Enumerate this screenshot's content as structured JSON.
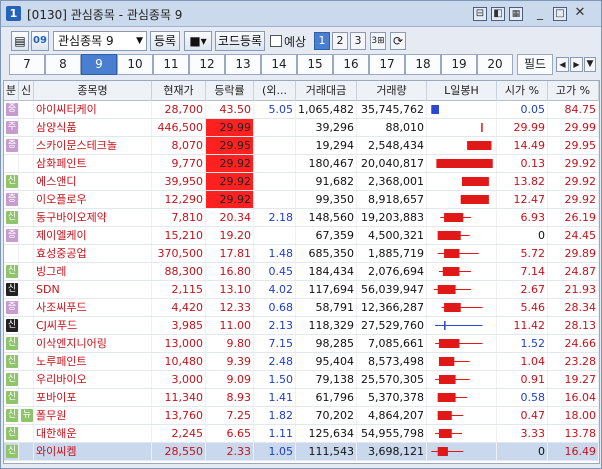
{
  "window": {
    "badge": "1",
    "title": "[0130] 관심종목 - 관심종목 9"
  },
  "toolbar": {
    "watchlist_value": "관심종목 9",
    "register_label": "등록",
    "code_register_label": "코드등록",
    "preview_label": "예상",
    "pages": [
      "1",
      "2",
      "3"
    ]
  },
  "tabs": {
    "items": [
      "7",
      "8",
      "9",
      "10",
      "11",
      "12",
      "13",
      "14",
      "15",
      "16",
      "17",
      "18",
      "19",
      "20"
    ],
    "field_label": "필드"
  },
  "colors": {
    "up": "#c8101a",
    "down": "#1d3fc4",
    "limit_up_bg": "#ff2020",
    "selected_row": "#c9d8ec"
  },
  "columns": [
    "분",
    "신",
    "종목명",
    "현재가",
    "등락률",
    "(외...",
    "거래대금",
    "거래량",
    "L일봉H",
    "시가 %",
    "고가 %"
  ],
  "rows": [
    {
      "div": "중",
      "div_color": "#c89bd0",
      "credit": "",
      "name": "아이씨티케이",
      "price": "28,700",
      "rate": "43.50",
      "foreign": "5.05",
      "amount": "1,065,482",
      "volume": "35,745,762",
      "open": "0.05",
      "high": "84.75",
      "color": "red",
      "limit": false,
      "open_color": "blue",
      "sel": false
    },
    {
      "div": "주",
      "div_color": "#c89bd0",
      "credit": "",
      "name": "삼양식품",
      "price": "446,500",
      "rate": "29.99",
      "foreign": "",
      "amount": "39,296",
      "volume": "88,010",
      "open": "29.99",
      "high": "29.99",
      "color": "red",
      "limit": true,
      "open_color": "red",
      "sel": false
    },
    {
      "div": "증",
      "div_color": "#c89bd0",
      "credit": "",
      "name": "스카이문스테크놀",
      "price": "8,070",
      "rate": "29.95",
      "foreign": "",
      "amount": "19,294",
      "volume": "2,548,434",
      "open": "14.49",
      "high": "29.95",
      "color": "red",
      "limit": true,
      "open_color": "red",
      "sel": false
    },
    {
      "div": "",
      "div_color": "",
      "credit": "",
      "name": "삼화페인트",
      "price": "9,770",
      "rate": "29.92",
      "foreign": "",
      "amount": "180,467",
      "volume": "20,040,817",
      "open": "0.13",
      "high": "29.92",
      "color": "red",
      "limit": true,
      "open_color": "red",
      "sel": false
    },
    {
      "div": "신",
      "div_color": "#8fc46a",
      "credit": "",
      "name": "에스앤디",
      "price": "39,950",
      "rate": "29.92",
      "foreign": "",
      "amount": "91,682",
      "volume": "2,368,001",
      "open": "13.82",
      "high": "29.92",
      "color": "red",
      "limit": true,
      "open_color": "red",
      "sel": false
    },
    {
      "div": "증",
      "div_color": "#c89bd0",
      "credit": "",
      "name": "이오플로우",
      "price": "12,290",
      "rate": "29.92",
      "foreign": "",
      "amount": "99,350",
      "volume": "8,918,657",
      "open": "12.47",
      "high": "29.92",
      "color": "red",
      "limit": true,
      "open_color": "red",
      "sel": false
    },
    {
      "div": "신",
      "div_color": "#8fc46a",
      "credit": "",
      "name": "동구바이오제약",
      "price": "7,810",
      "rate": "20.34",
      "foreign": "2.18",
      "amount": "148,560",
      "volume": "19,203,883",
      "open": "6.93",
      "high": "26.19",
      "color": "red",
      "limit": false,
      "open_color": "red",
      "sel": false
    },
    {
      "div": "증",
      "div_color": "#c89bd0",
      "credit": "",
      "name": "제이엘케이",
      "price": "15,210",
      "rate": "19.20",
      "foreign": "",
      "amount": "67,359",
      "volume": "4,500,321",
      "open": "0",
      "high": "24.45",
      "color": "red",
      "limit": false,
      "open_color": "black",
      "sel": false
    },
    {
      "div": "",
      "div_color": "",
      "credit": "",
      "name": "효성중공업",
      "price": "370,500",
      "rate": "17.81",
      "foreign": "1.48",
      "amount": "685,350",
      "volume": "1,885,719",
      "open": "5.72",
      "high": "29.89",
      "color": "red",
      "limit": false,
      "open_color": "red",
      "sel": false
    },
    {
      "div": "신",
      "div_color": "#8fc46a",
      "credit": "",
      "name": "빙그레",
      "price": "88,300",
      "rate": "16.80",
      "foreign": "0.45",
      "amount": "184,434",
      "volume": "2,076,694",
      "open": "7.14",
      "high": "24.87",
      "color": "red",
      "limit": false,
      "open_color": "red",
      "sel": false
    },
    {
      "div": "신",
      "div_color": "#222",
      "credit": "",
      "name": "SDN",
      "price": "2,115",
      "rate": "13.10",
      "foreign": "4.02",
      "amount": "117,694",
      "volume": "56,039,947",
      "open": "2.67",
      "high": "21.93",
      "color": "red",
      "limit": false,
      "open_color": "red",
      "sel": false
    },
    {
      "div": "증",
      "div_color": "#c89bd0",
      "credit": "",
      "name": "사조씨푸드",
      "price": "4,420",
      "rate": "12.33",
      "foreign": "0.68",
      "amount": "58,791",
      "volume": "12,366,287",
      "open": "5.46",
      "high": "28.34",
      "color": "red",
      "limit": false,
      "open_color": "red",
      "sel": false
    },
    {
      "div": "신",
      "div_color": "#222",
      "credit": "",
      "name": "CJ씨푸드",
      "price": "3,985",
      "rate": "11.00",
      "foreign": "2.13",
      "amount": "118,329",
      "volume": "27,529,760",
      "open": "11.42",
      "high": "28.13",
      "color": "red",
      "limit": false,
      "open_color": "red",
      "sel": false
    },
    {
      "div": "신",
      "div_color": "#8fc46a",
      "credit": "",
      "name": "이삭엔지니어링",
      "price": "13,000",
      "rate": "9.80",
      "foreign": "7.15",
      "amount": "98,285",
      "volume": "7,085,661",
      "open": "1.52",
      "high": "24.66",
      "color": "red",
      "limit": false,
      "open_color": "blue",
      "sel": false
    },
    {
      "div": "신",
      "div_color": "#8fc46a",
      "credit": "",
      "name": "노루페인트",
      "price": "10,480",
      "rate": "9.39",
      "foreign": "2.48",
      "amount": "95,404",
      "volume": "8,573,498",
      "open": "1.04",
      "high": "23.28",
      "color": "red",
      "limit": false,
      "open_color": "red",
      "sel": false
    },
    {
      "div": "신",
      "div_color": "#8fc46a",
      "credit": "",
      "name": "우리바이오",
      "price": "3,000",
      "rate": "9.09",
      "foreign": "1.50",
      "amount": "79,138",
      "volume": "25,570,305",
      "open": "0.91",
      "high": "19.27",
      "color": "red",
      "limit": false,
      "open_color": "red",
      "sel": false
    },
    {
      "div": "신",
      "div_color": "#8fc46a",
      "credit": "",
      "name": "포바이포",
      "price": "11,340",
      "rate": "8.93",
      "foreign": "1.41",
      "amount": "61,796",
      "volume": "5,370,378",
      "open": "0.58",
      "high": "16.04",
      "color": "red",
      "limit": false,
      "open_color": "blue",
      "sel": false
    },
    {
      "div": "신",
      "div_color": "#8fc46a",
      "credit": "뉴",
      "name": "폴무원",
      "price": "13,760",
      "rate": "7.25",
      "foreign": "1.82",
      "amount": "70,202",
      "volume": "4,864,207",
      "open": "0.47",
      "high": "18.00",
      "color": "red",
      "limit": false,
      "open_color": "red",
      "sel": false
    },
    {
      "div": "신",
      "div_color": "#8fc46a",
      "credit": "",
      "name": "대한해운",
      "price": "2,245",
      "rate": "6.65",
      "foreign": "1.11",
      "amount": "125,634",
      "volume": "54,955,798",
      "open": "3.33",
      "high": "13.78",
      "color": "red",
      "limit": false,
      "open_color": "red",
      "sel": false
    },
    {
      "div": "신",
      "div_color": "#8fc46a",
      "credit": "",
      "name": "와이씨켐",
      "price": "28,550",
      "rate": "2.33",
      "foreign": "1.05",
      "amount": "111,543",
      "volume": "3,698,121",
      "open": "0",
      "high": "16.49",
      "color": "red",
      "limit": false,
      "open_color": "black",
      "sel": true
    }
  ],
  "candles": [
    {
      "up": false,
      "body": [
        0.02,
        0.14
      ],
      "wick": [
        0.02,
        0.14
      ]
    },
    {
      "up": true,
      "body": [
        0.8,
        0.82
      ],
      "wick": [
        0.8,
        0.82
      ]
    },
    {
      "up": true,
      "body": [
        0.58,
        0.96
      ],
      "wick": [
        0.58,
        0.96
      ]
    },
    {
      "up": true,
      "body": [
        0.1,
        0.98
      ],
      "wick": [
        0.1,
        0.98
      ]
    },
    {
      "up": true,
      "body": [
        0.5,
        0.92
      ],
      "wick": [
        0.5,
        0.92
      ]
    },
    {
      "up": true,
      "body": [
        0.48,
        0.92
      ],
      "wick": [
        0.48,
        0.92
      ]
    },
    {
      "up": true,
      "body": [
        0.22,
        0.52
      ],
      "wick": [
        0.16,
        0.64
      ]
    },
    {
      "up": true,
      "body": [
        0.12,
        0.48
      ],
      "wick": [
        0.12,
        0.62
      ]
    },
    {
      "up": true,
      "body": [
        0.22,
        0.46
      ],
      "wick": [
        0.12,
        0.76
      ]
    },
    {
      "up": true,
      "body": [
        0.2,
        0.46
      ],
      "wick": [
        0.14,
        0.64
      ]
    },
    {
      "up": true,
      "body": [
        0.12,
        0.4
      ],
      "wick": [
        0.06,
        0.64
      ]
    },
    {
      "up": true,
      "body": [
        0.22,
        0.48
      ],
      "wick": [
        0.18,
        0.82
      ]
    },
    {
      "up": false,
      "body": [
        0.22,
        0.24
      ],
      "wick": [
        0.08,
        0.82
      ]
    },
    {
      "up": true,
      "body": [
        0.14,
        0.46
      ],
      "wick": [
        0.08,
        0.82
      ]
    },
    {
      "up": true,
      "body": [
        0.14,
        0.38
      ],
      "wick": [
        0.14,
        0.62
      ]
    },
    {
      "up": true,
      "body": [
        0.14,
        0.4
      ],
      "wick": [
        0.08,
        0.62
      ]
    },
    {
      "up": true,
      "body": [
        0.12,
        0.4
      ],
      "wick": [
        0.12,
        0.58
      ]
    },
    {
      "up": true,
      "body": [
        0.12,
        0.34
      ],
      "wick": [
        0.12,
        0.52
      ]
    },
    {
      "up": true,
      "body": [
        0.14,
        0.34
      ],
      "wick": [
        0.08,
        0.5
      ]
    },
    {
      "up": true,
      "body": [
        0.12,
        0.28
      ],
      "wick": [
        0.02,
        0.52
      ]
    }
  ]
}
